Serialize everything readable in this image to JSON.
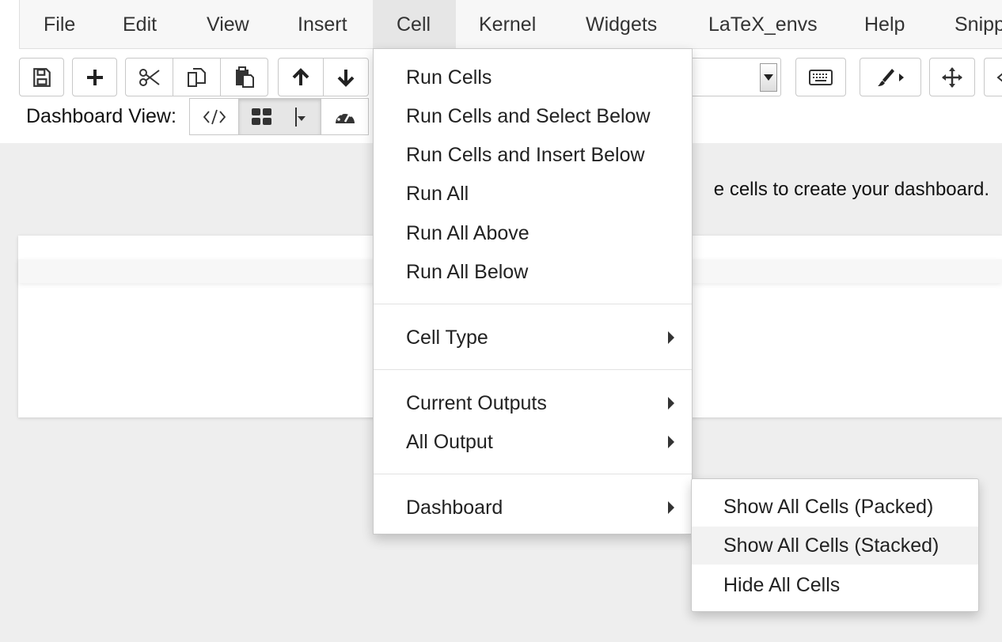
{
  "menubar": {
    "items": [
      {
        "label": "File"
      },
      {
        "label": "Edit"
      },
      {
        "label": "View"
      },
      {
        "label": "Insert"
      },
      {
        "label": "Cell"
      },
      {
        "label": "Kernel"
      },
      {
        "label": "Widgets"
      },
      {
        "label": "LaTeX_envs"
      },
      {
        "label": "Help"
      },
      {
        "label": "Snipp"
      }
    ],
    "open_menu": "Cell"
  },
  "toolbar": {
    "buttons": [
      "save-icon",
      "plus-icon",
      "scissors-icon",
      "copy-icon",
      "paste-icon",
      "arrow-up-icon",
      "arrow-down-icon",
      "keyboard-icon",
      "paintbrush-icon",
      "move-icon"
    ]
  },
  "dashboard": {
    "label": "Dashboard View:",
    "active_view": "grid"
  },
  "main": {
    "instructions": "e cells to create your dashboard."
  },
  "cell_menu": {
    "run_items": [
      {
        "label": "Run Cells"
      },
      {
        "label": "Run Cells and Select Below"
      },
      {
        "label": "Run Cells and Insert Below"
      },
      {
        "label": "Run All"
      },
      {
        "label": "Run All Above"
      },
      {
        "label": "Run All Below"
      }
    ],
    "cell_type": "Cell Type",
    "current_outputs": "Current Outputs",
    "all_output": "All Output",
    "dashboard": "Dashboard"
  },
  "dashboard_submenu": {
    "items": [
      {
        "label": "Show All Cells (Packed)"
      },
      {
        "label": "Show All Cells (Stacked)"
      },
      {
        "label": "Hide All Cells"
      }
    ],
    "hovered": "Show All Cells (Stacked)"
  }
}
